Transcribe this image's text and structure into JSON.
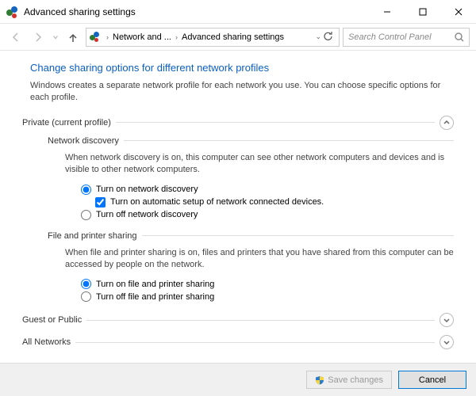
{
  "window": {
    "title": "Advanced sharing settings"
  },
  "breadcrumb": {
    "seg1": "Network and ...",
    "seg2": "Advanced sharing settings"
  },
  "search": {
    "placeholder": "Search Control Panel"
  },
  "page": {
    "title": "Change sharing options for different network profiles",
    "desc": "Windows creates a separate network profile for each network you use. You can choose specific options for each profile."
  },
  "sections": {
    "private": {
      "label": "Private (current profile)",
      "network_discovery": {
        "header": "Network discovery",
        "desc": "When network discovery is on, this computer can see other network computers and devices and is visible to other network computers.",
        "opt_on": "Turn on network discovery",
        "opt_auto": "Turn on automatic setup of network connected devices.",
        "opt_off": "Turn off network discovery"
      },
      "file_printer": {
        "header": "File and printer sharing",
        "desc": "When file and printer sharing is on, files and printers that you have shared from this computer can be accessed by people on the network.",
        "opt_on": "Turn on file and printer sharing",
        "opt_off": "Turn off file and printer sharing"
      }
    },
    "guest": {
      "label": "Guest or Public"
    },
    "all": {
      "label": "All Networks"
    }
  },
  "footer": {
    "save": "Save changes",
    "cancel": "Cancel"
  }
}
